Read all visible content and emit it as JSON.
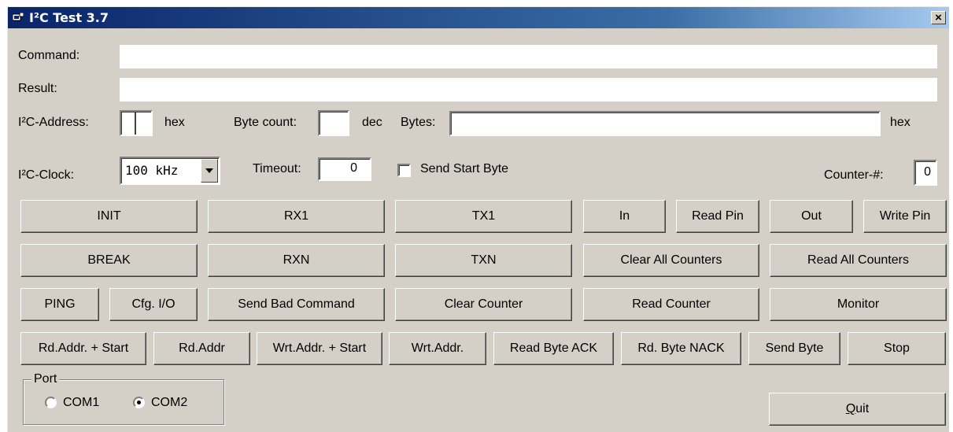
{
  "window": {
    "title": "I²C Test 3.7",
    "close_label": "×"
  },
  "fields": {
    "command_label": "Command:",
    "command_value": "",
    "result_label": "Result:",
    "result_value": "",
    "address_label": "I²C-Address:",
    "address_value": "",
    "address_unit": "hex",
    "bytecount_label": "Byte count:",
    "bytecount_value": "",
    "bytecount_unit": "dec",
    "bytes_label": "Bytes:",
    "bytes_value": "",
    "bytes_unit": "hex",
    "clock_label": "I²C-Clock:",
    "clock_value": "100 kHz",
    "timeout_label": "Timeout:",
    "timeout_value": "0",
    "startbyte_label": "Send Start Byte",
    "startbyte_checked": false,
    "counter_label": "Counter-#:",
    "counter_value": "0"
  },
  "buttons": {
    "init": "INIT",
    "rx1": "RX1",
    "tx1": "TX1",
    "in": "In",
    "read_pin": "Read Pin",
    "out": "Out",
    "write_pin": "Write Pin",
    "break": "BREAK",
    "rxn": "RXN",
    "txn": "TXN",
    "clear_all_counters": "Clear All Counters",
    "read_all_counters": "Read All Counters",
    "ping": "PING",
    "cfg_io": "Cfg. I/O",
    "send_bad_command": "Send Bad Command",
    "clear_counter": "Clear Counter",
    "read_counter": "Read Counter",
    "monitor": "Monitor",
    "rd_addr_start": "Rd.Addr. + Start",
    "rd_addr": "Rd.Addr",
    "wrt_addr_start": "Wrt.Addr. + Start",
    "wrt_addr": "Wrt.Addr.",
    "read_byte_ack": "Read Byte ACK",
    "rd_byte_nack": "Rd. Byte NACK",
    "send_byte": "Send Byte",
    "stop": "Stop",
    "quit_accel": "Q",
    "quit_rest": "uit"
  },
  "port": {
    "legend": "Port",
    "options": [
      "COM1",
      "COM2"
    ],
    "selected": "COM2"
  }
}
